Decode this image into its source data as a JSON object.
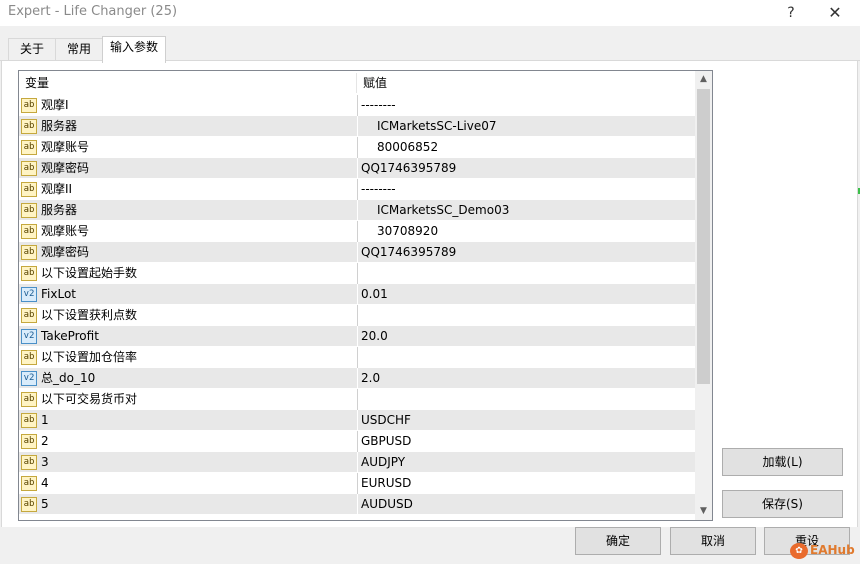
{
  "window": {
    "title": "Expert - Life Changer   (25)",
    "help_glyph": "?",
    "close_glyph": "✕"
  },
  "tabs": [
    {
      "label": "关于"
    },
    {
      "label": "常用"
    },
    {
      "label": "输入参数"
    }
  ],
  "grid": {
    "headers": {
      "variable": "变量",
      "value": "赋值"
    },
    "rows": [
      {
        "icon": "ab",
        "name": "观摩I",
        "value": "--------"
      },
      {
        "icon": "ab",
        "name": "服务器",
        "value": "ICMarketsSC-Live07"
      },
      {
        "icon": "ab",
        "name": "观摩账号",
        "value": "80006852"
      },
      {
        "icon": "ab",
        "name": "观摩密码",
        "value": "QQ1746395789"
      },
      {
        "icon": "ab",
        "name": "观摩II",
        "value": "--------"
      },
      {
        "icon": "ab",
        "name": "服务器",
        "value": "ICMarketsSC_Demo03"
      },
      {
        "icon": "ab",
        "name": "观摩账号",
        "value": "30708920"
      },
      {
        "icon": "ab",
        "name": "观摩密码",
        "value": "QQ1746395789"
      },
      {
        "icon": "ab",
        "name": "以下设置起始手数",
        "value": ""
      },
      {
        "icon": "v2",
        "name": "FixLot",
        "value": "0.01"
      },
      {
        "icon": "ab",
        "name": "以下设置获利点数",
        "value": ""
      },
      {
        "icon": "v2",
        "name": "TakeProfit",
        "value": "20.0"
      },
      {
        "icon": "ab",
        "name": "以下设置加仓倍率",
        "value": ""
      },
      {
        "icon": "v2",
        "name": "总_do_10",
        "value": "2.0"
      },
      {
        "icon": "ab",
        "name": "以下可交易货币对",
        "value": ""
      },
      {
        "icon": "ab",
        "name": "1",
        "value": "USDCHF"
      },
      {
        "icon": "ab",
        "name": "2",
        "value": "GBPUSD"
      },
      {
        "icon": "ab",
        "name": "3",
        "value": "AUDJPY"
      },
      {
        "icon": "ab",
        "name": "4",
        "value": "EURUSD"
      },
      {
        "icon": "ab",
        "name": "5",
        "value": "AUDUSD"
      }
    ],
    "scroll_up_glyph": "▲",
    "scroll_down_glyph": "▼"
  },
  "buttons": {
    "load": "加载(L)",
    "save": "保存(S)",
    "ok": "确定",
    "cancel": "取消",
    "reset": "重设"
  },
  "watermark": {
    "text": "EAHub"
  }
}
